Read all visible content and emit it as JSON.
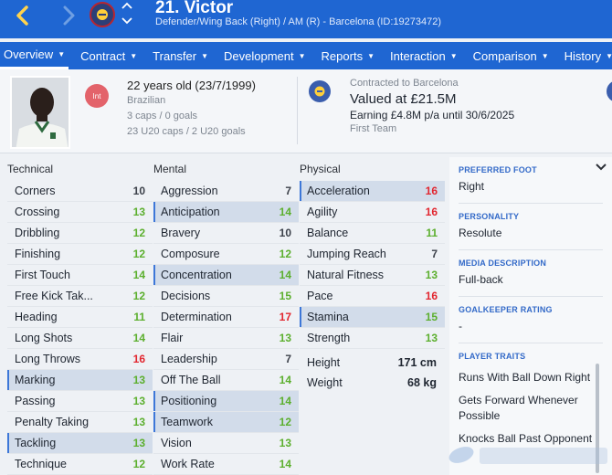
{
  "header": {
    "name": "21. Victor",
    "subtitle": "Defender/Wing Back (Right) / AM (R) - Barcelona (ID:19273472)",
    "back_icon": "chevron-left-icon",
    "forward_icon": "chevron-right-icon"
  },
  "tabs": [
    {
      "label": "Overview"
    },
    {
      "label": "Contract"
    },
    {
      "label": "Transfer"
    },
    {
      "label": "Development"
    },
    {
      "label": "Reports"
    },
    {
      "label": "Interaction"
    },
    {
      "label": "Comparison"
    },
    {
      "label": "History"
    }
  ],
  "profile": {
    "age": "22 years old (23/7/1999)",
    "nationality": "Brazilian",
    "int_badge": "Int",
    "caps": "3 caps / 0 goals",
    "u20_caps": "23 U20 caps / 2 U20 goals",
    "contract_status": "Contracted to Barcelona",
    "value": "Valued at £21.5M",
    "earning": "Earning £4.8M p/a until 30/6/2025",
    "squad": "First Team"
  },
  "technical": {
    "title": "Technical",
    "rows": [
      {
        "name": "Corners",
        "value": "10",
        "hl": false
      },
      {
        "name": "Crossing",
        "value": "13",
        "hl": false
      },
      {
        "name": "Dribbling",
        "value": "12",
        "hl": false
      },
      {
        "name": "Finishing",
        "value": "12",
        "hl": false
      },
      {
        "name": "First Touch",
        "value": "14",
        "hl": false
      },
      {
        "name": "Free Kick Tak...",
        "value": "12",
        "hl": false
      },
      {
        "name": "Heading",
        "value": "11",
        "hl": false
      },
      {
        "name": "Long Shots",
        "value": "14",
        "hl": false
      },
      {
        "name": "Long Throws",
        "value": "16",
        "hl": false
      },
      {
        "name": "Marking",
        "value": "13",
        "hl": true
      },
      {
        "name": "Passing",
        "value": "13",
        "hl": false
      },
      {
        "name": "Penalty Taking",
        "value": "13",
        "hl": false
      },
      {
        "name": "Tackling",
        "value": "13",
        "hl": true
      },
      {
        "name": "Technique",
        "value": "12",
        "hl": false
      }
    ]
  },
  "mental": {
    "title": "Mental",
    "rows": [
      {
        "name": "Aggression",
        "value": "7",
        "hl": false
      },
      {
        "name": "Anticipation",
        "value": "14",
        "hl": true
      },
      {
        "name": "Bravery",
        "value": "10",
        "hl": false
      },
      {
        "name": "Composure",
        "value": "12",
        "hl": false
      },
      {
        "name": "Concentration",
        "value": "14",
        "hl": true
      },
      {
        "name": "Decisions",
        "value": "15",
        "hl": false
      },
      {
        "name": "Determination",
        "value": "17",
        "hl": false
      },
      {
        "name": "Flair",
        "value": "13",
        "hl": false
      },
      {
        "name": "Leadership",
        "value": "7",
        "hl": false
      },
      {
        "name": "Off The Ball",
        "value": "14",
        "hl": false
      },
      {
        "name": "Positioning",
        "value": "14",
        "hl": true
      },
      {
        "name": "Teamwork",
        "value": "12",
        "hl": true
      },
      {
        "name": "Vision",
        "value": "13",
        "hl": false
      },
      {
        "name": "Work Rate",
        "value": "14",
        "hl": false
      }
    ]
  },
  "physical": {
    "title": "Physical",
    "rows": [
      {
        "name": "Acceleration",
        "value": "16",
        "hl": true
      },
      {
        "name": "Agility",
        "value": "16",
        "hl": false
      },
      {
        "name": "Balance",
        "value": "11",
        "hl": false
      },
      {
        "name": "Jumping Reach",
        "value": "7",
        "hl": false
      },
      {
        "name": "Natural Fitness",
        "value": "13",
        "hl": false
      },
      {
        "name": "Pace",
        "value": "16",
        "hl": false
      },
      {
        "name": "Stamina",
        "value": "15",
        "hl": true
      },
      {
        "name": "Strength",
        "value": "13",
        "hl": false
      }
    ],
    "height_label": "Height",
    "height_value": "171 cm",
    "weight_label": "Weight",
    "weight_value": "68 kg"
  },
  "details": {
    "preferred_foot_title": "PREFERRED FOOT",
    "preferred_foot": "Right",
    "personality_title": "PERSONALITY",
    "personality": "Resolute",
    "media_title": "MEDIA DESCRIPTION",
    "media": "Full-back",
    "gk_title": "GOALKEEPER RATING",
    "gk": "-",
    "traits_title": "PLAYER TRAITS",
    "traits": [
      "Runs With Ball Down Right",
      "Gets Forward Whenever Possible",
      "Knocks Ball Past Opponent"
    ]
  },
  "colors": {
    "header_blue": "#1f66d2",
    "value_gray": "#3c414a",
    "value_green": "#5caf2e",
    "value_red": "#e2262f",
    "highlight": "#d2dcea"
  }
}
